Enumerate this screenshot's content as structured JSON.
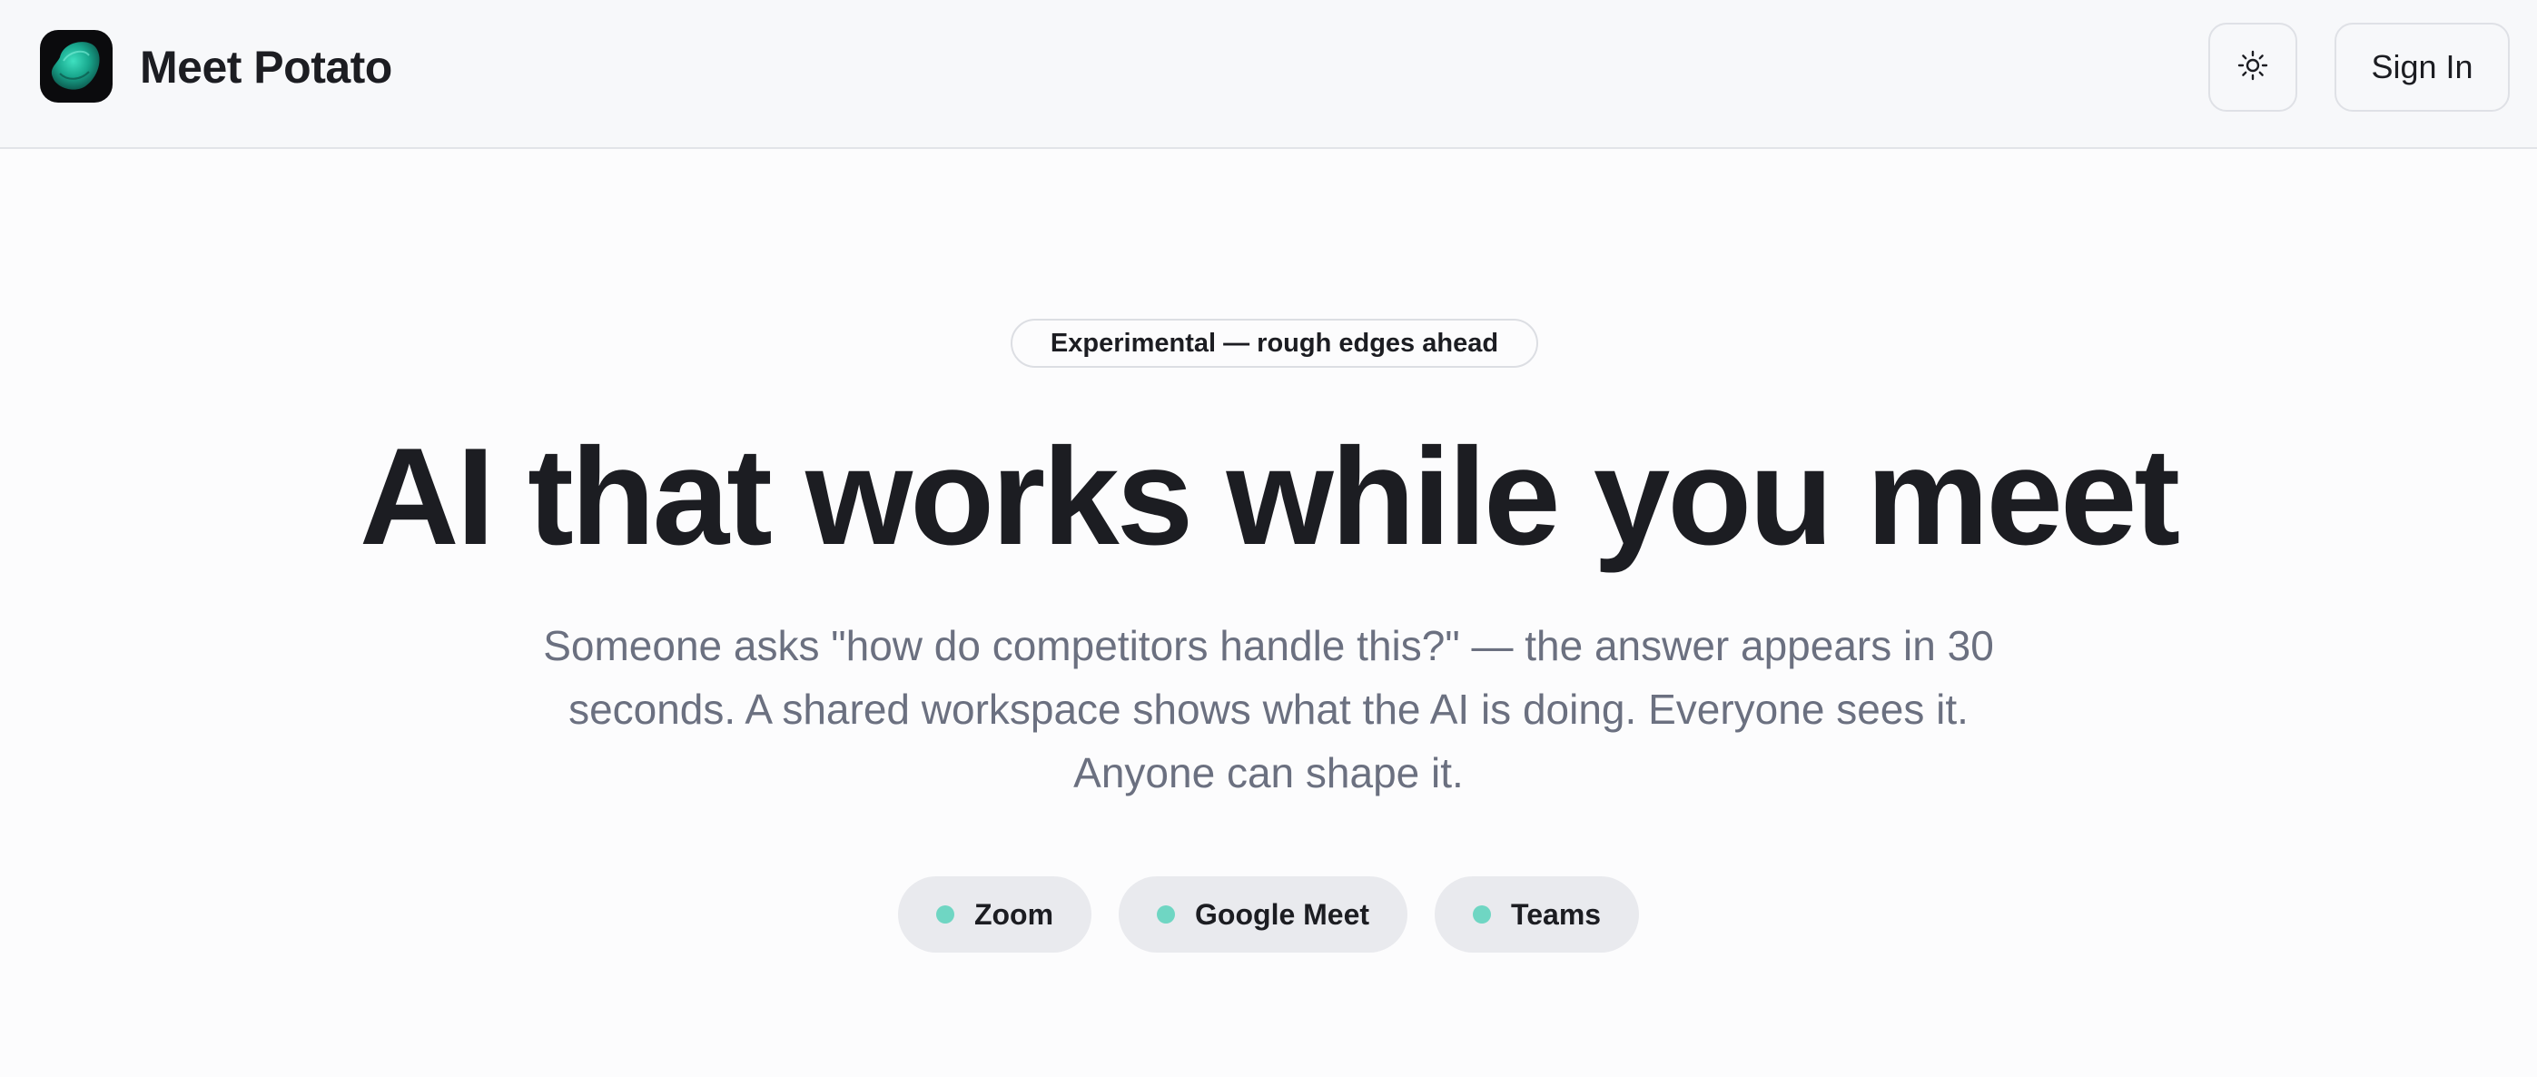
{
  "header": {
    "brand": "Meet Potato",
    "logo_icon": "potato-logo-icon",
    "theme_icon": "sun-icon",
    "sign_in_label": "Sign In"
  },
  "hero": {
    "badge": "Experimental — rough edges ahead",
    "headline": "AI that works while you meet",
    "subtitle": "Someone asks \"how do competitors handle this?\" — the answer appears in 30 seconds. A shared workspace shows what the AI is doing. Everyone sees it. Anyone can shape it."
  },
  "platforms": [
    {
      "label": "Zoom",
      "dot_color": "#6fd6c3"
    },
    {
      "label": "Google Meet",
      "dot_color": "#6fd6c3"
    },
    {
      "label": "Teams",
      "dot_color": "#6fd6c3"
    }
  ],
  "colors": {
    "accent": "#6fd6c3",
    "text": "#1c1d22",
    "muted": "#6b7080",
    "pill_bg": "#e9eaee"
  }
}
